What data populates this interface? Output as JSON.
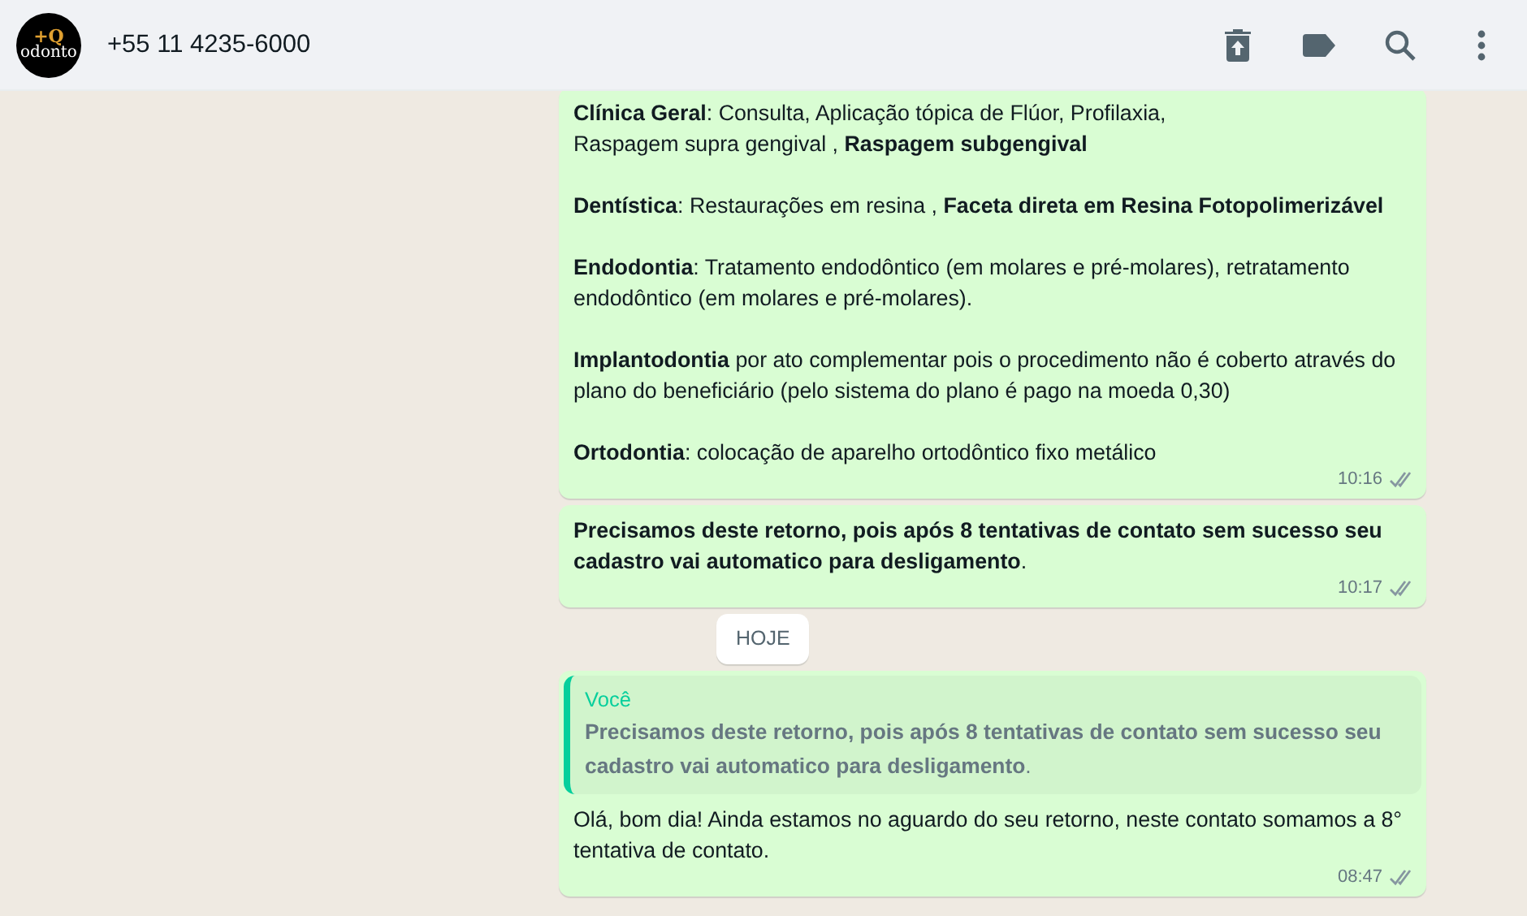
{
  "header": {
    "avatar": {
      "logo_text": "odonto",
      "mark": "+Q"
    },
    "contact": "+55 11 4235-6000",
    "actions": [
      {
        "kind": "unarchive"
      },
      {
        "kind": "label"
      },
      {
        "kind": "search"
      },
      {
        "kind": "menu"
      }
    ]
  },
  "messages": [
    {
      "kind": "message",
      "paragraphs": [
        {
          "lines": [
            "**Clínica Geral**: Consulta, Aplicação tópica de Flúor, Profilaxia,",
            "Raspagem supra gengival , **Raspagem subgengival**"
          ]
        },
        {
          "lines": [
            "**Dentística**: Restaurações em resina , **Faceta direta em Resina Fotopolimerizável**"
          ]
        },
        {
          "lines": [
            "**Endodontia**: Tratamento endodôntico (em molares e pré-molares), retratamento endodôntico (em molares e pré-molares)."
          ]
        },
        {
          "lines": [
            "**Implantodontia** por ato complementar pois o procedimento não é coberto através do plano do beneficiário (pelo sistema do plano é pago na moeda 0,30)"
          ]
        },
        {
          "lines": [
            "**Ortodontia**: colocação de aparelho ortodôntico fixo metálico"
          ]
        }
      ],
      "time": "10:16",
      "read": false
    },
    {
      "kind": "message",
      "paragraphs": [
        {
          "lines": [
            "**Precisamos deste retorno, pois após 8 tentativas de contato sem sucesso seu cadastro vai automatico para desligamento**."
          ]
        }
      ],
      "time": "10:17",
      "read": false
    },
    {
      "kind": "day",
      "label": "HOJE"
    },
    {
      "kind": "message",
      "quote": {
        "author": "Você",
        "text": "**Precisamos deste retorno, pois após 8 tentativas de contato sem sucesso seu cadastro vai automatico para desligamento**."
      },
      "paragraphs": [
        {
          "lines": [
            "Olá, bom dia! Ainda estamos no aguardo do seu retorno, neste contato somamos a 8° tentativa de contato."
          ]
        }
      ],
      "time": "08:47",
      "read": false
    }
  ]
}
